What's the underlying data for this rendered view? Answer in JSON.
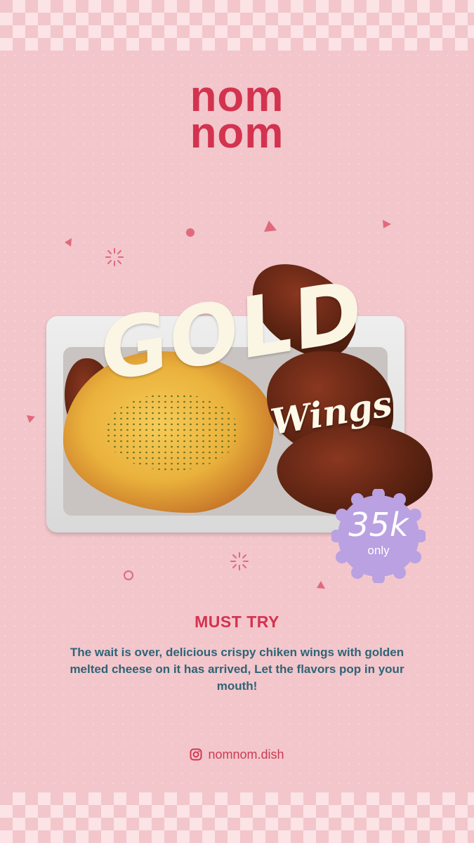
{
  "brand": {
    "line1": "nom",
    "line2": "nom"
  },
  "product": {
    "title": "GOLD",
    "subtitle": "Wings",
    "price": "35k",
    "price_note": "only"
  },
  "tagline": "MUST TRY",
  "description": "The wait is over, delicious crispy chiken wings with golden melted cheese on it has arrived, Let the flavors pop in your mouth!",
  "social": {
    "icon": "instagram-icon",
    "handle": "nomnom.dish"
  },
  "colors": {
    "background": "#f2c6cb",
    "accent_red": "#d3334f",
    "text_teal": "#2f6477",
    "badge_purple": "#b9a1e2",
    "cream": "#fbf5e4"
  }
}
